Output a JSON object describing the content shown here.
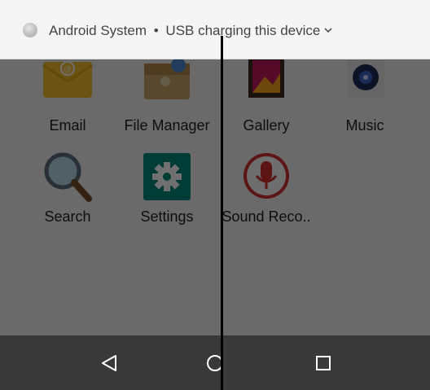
{
  "notification": {
    "app_name": "Android System",
    "separator": "•",
    "message": "USB charging this device",
    "icon": "android-system-icon",
    "expand_icon": "chevron-down-icon"
  },
  "apps": [
    {
      "label": "Email",
      "icon": "email-icon"
    },
    {
      "label": "File Manager",
      "icon": "file-manager-icon"
    },
    {
      "label": "Gallery",
      "icon": "gallery-icon"
    },
    {
      "label": "Music",
      "icon": "music-icon"
    },
    {
      "label": "Search",
      "icon": "search-icon"
    },
    {
      "label": "Settings",
      "icon": "settings-icon"
    },
    {
      "label": "Sound Reco..",
      "icon": "sound-recorder-icon"
    }
  ],
  "navbar": {
    "back_icon": "back-icon",
    "home_icon": "home-icon",
    "recents_icon": "recents-icon"
  },
  "colors": {
    "scrim": "#000000",
    "settings_teal": "#00897b",
    "recorder_red": "#d32f2f"
  }
}
